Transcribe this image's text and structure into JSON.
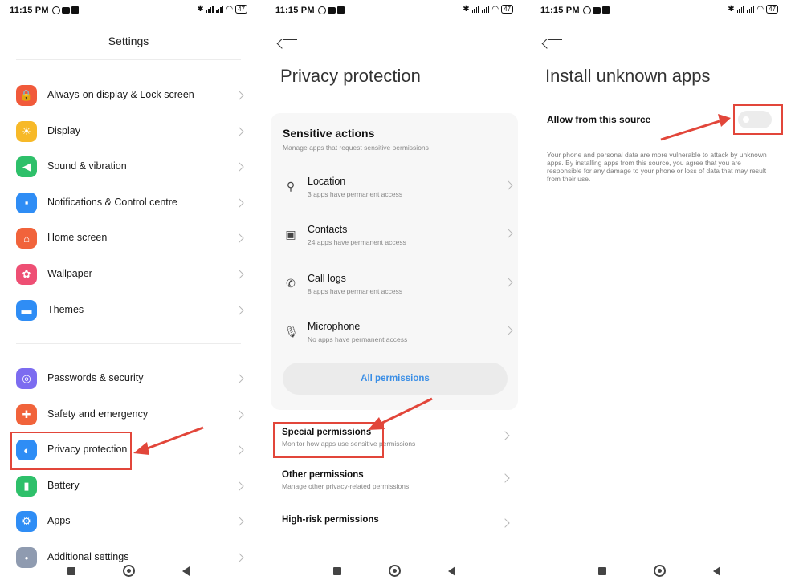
{
  "status_bar": {
    "time": "11:15 PM",
    "battery": "47"
  },
  "screen1": {
    "title": "Settings",
    "items_group1": [
      {
        "label": "Always-on display & Lock screen",
        "icon": "lock-icon",
        "color": "#f15a3b",
        "glyph": "🔒"
      },
      {
        "label": "Display",
        "icon": "sun-icon",
        "color": "#f7b928",
        "glyph": "☀"
      },
      {
        "label": "Sound & vibration",
        "icon": "speaker-icon",
        "color": "#2ec06a",
        "glyph": "◀"
      },
      {
        "label": "Notifications & Control centre",
        "icon": "notification-icon",
        "color": "#2f8df5",
        "glyph": "▪"
      },
      {
        "label": "Home screen",
        "icon": "home-icon",
        "color": "#f1633b",
        "glyph": "⌂"
      },
      {
        "label": "Wallpaper",
        "icon": "flower-icon",
        "color": "#ee4f74",
        "glyph": "✿"
      },
      {
        "label": "Themes",
        "icon": "themes-icon",
        "color": "#2f8df5",
        "glyph": "▬"
      }
    ],
    "items_group2": [
      {
        "label": "Passwords & security",
        "icon": "fingerprint-icon",
        "color": "#7c6cf0",
        "glyph": "◎"
      },
      {
        "label": "Safety and emergency",
        "icon": "safety-icon",
        "color": "#f1633b",
        "glyph": "✚"
      },
      {
        "label": "Privacy protection",
        "icon": "privacy-icon",
        "color": "#2f8df5",
        "glyph": "◐"
      },
      {
        "label": "Battery",
        "icon": "battery-icon",
        "color": "#2ec06a",
        "glyph": "▮"
      },
      {
        "label": "Apps",
        "icon": "gear-icon",
        "color": "#2f8df5",
        "glyph": "⚙"
      },
      {
        "label": "Additional settings",
        "icon": "more-icon",
        "color": "#8f9bb0",
        "glyph": "•"
      }
    ]
  },
  "screen2": {
    "title": "Privacy protection",
    "card_heading": "Sensitive actions",
    "card_sub": "Manage apps that request sensitive permissions",
    "permissions": [
      {
        "title": "Location",
        "sub": "3 apps have permanent access",
        "icon": "location-icon",
        "glyph": "⚲"
      },
      {
        "title": "Contacts",
        "sub": "24 apps have permanent access",
        "icon": "contacts-icon",
        "glyph": "▣"
      },
      {
        "title": "Call logs",
        "sub": "8 apps have permanent access",
        "icon": "call-log-icon",
        "glyph": "✆"
      },
      {
        "title": "Microphone",
        "sub": "No apps have permanent access",
        "icon": "microphone-icon",
        "glyph": "🎙"
      }
    ],
    "all_permissions": "All permissions",
    "others": [
      {
        "title": "Special permissions",
        "sub": "Monitor how apps use sensitive permissions"
      },
      {
        "title": "Other permissions",
        "sub": "Manage other privacy-related permissions"
      },
      {
        "title": "High-risk permissions",
        "sub": ""
      }
    ]
  },
  "screen3": {
    "title": "Install unknown apps",
    "toggle_label": "Allow from this source",
    "toggle_state": "off",
    "warning": "Your phone and personal data are more vulnerable to attack by unknown apps. By installing apps from this source, you agree that you are responsible for any damage to your phone or loss of data that may result from their use."
  }
}
